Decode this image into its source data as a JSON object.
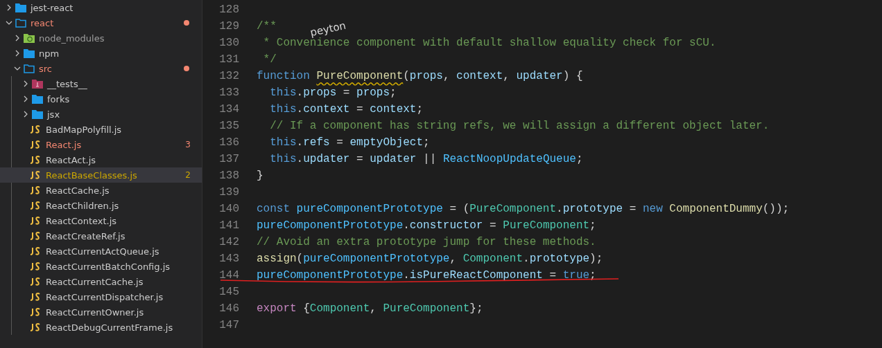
{
  "explorer": {
    "items": [
      {
        "name": "jest-react",
        "kind": "folder",
        "expanded": false,
        "selected": false
      },
      {
        "name": "react",
        "kind": "folder",
        "expanded": true,
        "selected": false,
        "color": "#f48771",
        "dot": true,
        "children": [
          {
            "name": "node_modules",
            "kind": "modules-folder",
            "expanded": false,
            "selected": false
          },
          {
            "name": "npm",
            "kind": "folder",
            "expanded": false,
            "selected": false
          },
          {
            "name": "src",
            "kind": "folder",
            "expanded": true,
            "selected": false,
            "color": "#f48771",
            "dot": true,
            "children": [
              {
                "name": "__tests__",
                "kind": "test-folder",
                "expanded": false,
                "selected": false
              },
              {
                "name": "forks",
                "kind": "folder",
                "expanded": false,
                "selected": false
              },
              {
                "name": "jsx",
                "kind": "folder",
                "expanded": false,
                "selected": false
              },
              {
                "name": "BadMapPolyfill.js",
                "kind": "js",
                "selected": false
              },
              {
                "name": "React.js",
                "kind": "js",
                "selected": false,
                "color": "#f48771",
                "badge": "3"
              },
              {
                "name": "ReactAct.js",
                "kind": "js",
                "selected": false
              },
              {
                "name": "ReactBaseClasses.js",
                "kind": "js",
                "selected": true,
                "color": "#cca700",
                "badge": "2"
              },
              {
                "name": "ReactCache.js",
                "kind": "js",
                "selected": false
              },
              {
                "name": "ReactChildren.js",
                "kind": "js",
                "selected": false
              },
              {
                "name": "ReactContext.js",
                "kind": "js",
                "selected": false
              },
              {
                "name": "ReactCreateRef.js",
                "kind": "js",
                "selected": false
              },
              {
                "name": "ReactCurrentActQueue.js",
                "kind": "js",
                "selected": false
              },
              {
                "name": "ReactCurrentBatchConfig.js",
                "kind": "js",
                "selected": false
              },
              {
                "name": "ReactCurrentCache.js",
                "kind": "js",
                "selected": false
              },
              {
                "name": "ReactCurrentDispatcher.js",
                "kind": "js",
                "selected": false
              },
              {
                "name": "ReactCurrentOwner.js",
                "kind": "js",
                "selected": false
              },
              {
                "name": "ReactDebugCurrentFrame.js",
                "kind": "js",
                "selected": false
              }
            ]
          }
        ]
      }
    ]
  },
  "editor": {
    "lines": [
      {
        "number": "128"
      },
      {
        "number": "129",
        "tokens": [
          {
            "text": "/**",
            "kind": "comment"
          }
        ]
      },
      {
        "number": "130",
        "tokens": [
          {
            "text": " * Convenience component with default shallow equality check for sCU.",
            "kind": "comment"
          }
        ]
      },
      {
        "number": "131",
        "tokens": [
          {
            "text": " */",
            "kind": "comment"
          }
        ]
      },
      {
        "number": "132",
        "tokens": [
          {
            "text": "function ",
            "kind": "keyword"
          },
          {
            "text": "PureComponent",
            "kind": "func",
            "squiggle": true
          },
          {
            "text": "(",
            "kind": "plain"
          },
          {
            "text": "props",
            "kind": "var"
          },
          {
            "text": ", ",
            "kind": "plain"
          },
          {
            "text": "context",
            "kind": "var"
          },
          {
            "text": ", ",
            "kind": "plain"
          },
          {
            "text": "updater",
            "kind": "var"
          },
          {
            "text": ") {",
            "kind": "plain"
          }
        ]
      },
      {
        "number": "133",
        "tokens": [
          {
            "text": "  this",
            "kind": "keyword"
          },
          {
            "text": ".",
            "kind": "plain"
          },
          {
            "text": "props",
            "kind": "var"
          },
          {
            "text": " = ",
            "kind": "plain"
          },
          {
            "text": "props",
            "kind": "var"
          },
          {
            "text": ";",
            "kind": "plain"
          }
        ]
      },
      {
        "number": "134",
        "tokens": [
          {
            "text": "  this",
            "kind": "keyword"
          },
          {
            "text": ".",
            "kind": "plain"
          },
          {
            "text": "context",
            "kind": "var"
          },
          {
            "text": " = ",
            "kind": "plain"
          },
          {
            "text": "context",
            "kind": "var"
          },
          {
            "text": ";",
            "kind": "plain"
          }
        ]
      },
      {
        "number": "135",
        "tokens": [
          {
            "text": "  // If a component has string refs, we will assign a different object later.",
            "kind": "comment"
          }
        ]
      },
      {
        "number": "136",
        "tokens": [
          {
            "text": "  this",
            "kind": "keyword"
          },
          {
            "text": ".",
            "kind": "plain"
          },
          {
            "text": "refs",
            "kind": "var"
          },
          {
            "text": " = ",
            "kind": "plain"
          },
          {
            "text": "emptyObject",
            "kind": "var"
          },
          {
            "text": ";",
            "kind": "plain"
          }
        ]
      },
      {
        "number": "137",
        "tokens": [
          {
            "text": "  this",
            "kind": "keyword"
          },
          {
            "text": ".",
            "kind": "plain"
          },
          {
            "text": "updater",
            "kind": "var"
          },
          {
            "text": " = ",
            "kind": "plain"
          },
          {
            "text": "updater",
            "kind": "var"
          },
          {
            "text": " || ",
            "kind": "plain"
          },
          {
            "text": "ReactNoopUpdateQueue",
            "kind": "const"
          },
          {
            "text": ";",
            "kind": "plain"
          }
        ]
      },
      {
        "number": "138",
        "tokens": [
          {
            "text": "}",
            "kind": "plain"
          }
        ]
      },
      {
        "number": "139"
      },
      {
        "number": "140",
        "tokens": [
          {
            "text": "const ",
            "kind": "keyword"
          },
          {
            "text": "pureComponentPrototype",
            "kind": "const"
          },
          {
            "text": " = (",
            "kind": "plain"
          },
          {
            "text": "PureComponent",
            "kind": "class"
          },
          {
            "text": ".",
            "kind": "plain"
          },
          {
            "text": "prototype",
            "kind": "var"
          },
          {
            "text": " = ",
            "kind": "plain"
          },
          {
            "text": "new ",
            "kind": "keyword"
          },
          {
            "text": "ComponentDummy",
            "kind": "func"
          },
          {
            "text": "());",
            "kind": "plain"
          }
        ]
      },
      {
        "number": "141",
        "tokens": [
          {
            "text": "pureComponentPrototype",
            "kind": "const"
          },
          {
            "text": ".",
            "kind": "plain"
          },
          {
            "text": "constructor",
            "kind": "var"
          },
          {
            "text": " = ",
            "kind": "plain"
          },
          {
            "text": "PureComponent",
            "kind": "class"
          },
          {
            "text": ";",
            "kind": "plain"
          }
        ]
      },
      {
        "number": "142",
        "tokens": [
          {
            "text": "// Avoid an extra prototype jump for these methods.",
            "kind": "comment"
          }
        ]
      },
      {
        "number": "143",
        "tokens": [
          {
            "text": "assign",
            "kind": "func"
          },
          {
            "text": "(",
            "kind": "plain"
          },
          {
            "text": "pureComponentPrototype",
            "kind": "const"
          },
          {
            "text": ", ",
            "kind": "plain"
          },
          {
            "text": "Component",
            "kind": "class"
          },
          {
            "text": ".",
            "kind": "plain"
          },
          {
            "text": "prototype",
            "kind": "var"
          },
          {
            "text": ");",
            "kind": "plain"
          }
        ]
      },
      {
        "number": "144",
        "underlined": true,
        "tokens": [
          {
            "text": "pureComponentPrototype",
            "kind": "const"
          },
          {
            "text": ".",
            "kind": "plain"
          },
          {
            "text": "isPureReactComponent",
            "kind": "var"
          },
          {
            "text": " = ",
            "kind": "plain"
          },
          {
            "text": "true",
            "kind": "keyword"
          },
          {
            "text": ";",
            "kind": "plain"
          }
        ]
      },
      {
        "number": "145"
      },
      {
        "number": "146",
        "tokens": [
          {
            "text": "export ",
            "kind": "control"
          },
          {
            "text": "{",
            "kind": "plain"
          },
          {
            "text": "Component",
            "kind": "class"
          },
          {
            "text": ", ",
            "kind": "plain"
          },
          {
            "text": "PureComponent",
            "kind": "class"
          },
          {
            "text": "};",
            "kind": "plain"
          }
        ]
      },
      {
        "number": "147"
      }
    ],
    "annotation": {
      "text": "peyton"
    }
  }
}
